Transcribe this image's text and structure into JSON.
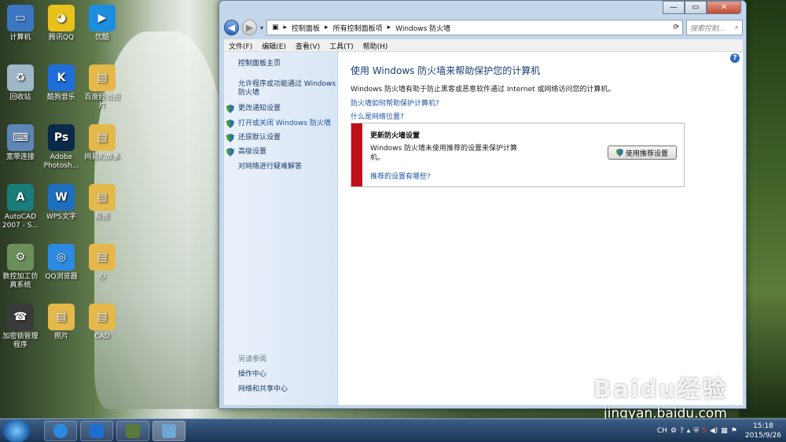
{
  "desktop": {
    "icons": [
      {
        "label": "计算机",
        "color": "#3c76c2",
        "glyph": "▭",
        "icon": "computer-icon"
      },
      {
        "label": "腾讯QQ",
        "color": "#e8c21a",
        "glyph": "◕",
        "icon": "qq-icon"
      },
      {
        "label": "优酷",
        "color": "#1c8ee0",
        "glyph": "▶",
        "icon": "youku-icon"
      },
      {
        "label": "回收站",
        "color": "#9fb6c9",
        "glyph": "♻",
        "icon": "recycle-bin-icon"
      },
      {
        "label": "酷狗音乐",
        "color": "#1e6fd9",
        "glyph": "K",
        "icon": "kugou-icon"
      },
      {
        "label": "百度经验图片",
        "color": "#e4b84a",
        "glyph": "▤",
        "icon": "folder-icon"
      },
      {
        "label": "宽带连接",
        "color": "#5e87b8",
        "glyph": "⌨",
        "icon": "broadband-icon"
      },
      {
        "label": "Adobe Photosh...",
        "color": "#0b2a4a",
        "glyph": "Ps",
        "icon": "photoshop-icon"
      },
      {
        "label": "网易的故事",
        "color": "#e4b84a",
        "glyph": "▤",
        "icon": "folder-icon"
      },
      {
        "label": "AutoCAD 2007 - S...",
        "color": "#1a7c7a",
        "glyph": "A",
        "icon": "autocad-icon"
      },
      {
        "label": "WPS文字",
        "color": "#1f6fbf",
        "glyph": "W",
        "icon": "wps-icon"
      },
      {
        "label": "原图",
        "color": "#e4b84a",
        "glyph": "▤",
        "icon": "folder-icon"
      },
      {
        "label": "数控加工仿真系统",
        "color": "#6b8f5a",
        "glyph": "⚙",
        "icon": "cnc-sim-icon"
      },
      {
        "label": "QQ浏览器",
        "color": "#2c8be0",
        "glyph": "◎",
        "icon": "qq-browser-icon"
      },
      {
        "label": "心",
        "color": "#e4b84a",
        "glyph": "▤",
        "icon": "folder-icon"
      },
      {
        "label": "加密锁管理程序",
        "color": "#3a3a3a",
        "glyph": "☎",
        "icon": "dongle-manager-icon"
      },
      {
        "label": "照片",
        "color": "#e4b84a",
        "glyph": "▤",
        "icon": "folder-icon"
      },
      {
        "label": "CAD",
        "color": "#e4b84a",
        "glyph": "▤",
        "icon": "folder-icon"
      }
    ]
  },
  "window": {
    "breadcrumb": [
      "控制面板",
      "所有控制面板项",
      "Windows 防火墙"
    ],
    "search_placeholder": "搜索控制...",
    "menu": [
      "文件(F)",
      "编辑(E)",
      "查看(V)",
      "工具(T)",
      "帮助(H)"
    ],
    "left": {
      "home": "控制面板主页",
      "allow_line1": "允许程序或功能通过 Windows",
      "allow_line2": "防火墙",
      "change_notify": "更改通知设置",
      "toggle_firewall": "打开或关闭 Windows 防火墙",
      "restore_defaults": "还原默认设置",
      "advanced": "高级设置",
      "troubleshoot": "对网络进行疑难解答",
      "see_also": "另请参阅",
      "action_center": "操作中心",
      "network_center": "网络和共享中心"
    },
    "main": {
      "title": "使用 Windows 防火墙来帮助保护您的计算机",
      "desc": "Windows 防火墙有助于防止黑客或恶意软件通过 Internet 或网络访问您的计算机。",
      "link_how": "防火墙如何帮助保护计算机?",
      "link_location": "什么是网络位置?",
      "panel_title": "更新防火墙设置",
      "panel_desc": "Windows 防火墙未使用推荐的设置来保护计算机。",
      "panel_link": "推荐的设置有哪些?",
      "use_recommended": "使用推荐设置"
    }
  },
  "watermark": {
    "logo": "Baidu经验",
    "url": "jingyan.baidu.com"
  },
  "taskbar": {
    "tray_lang": "CH",
    "time": "15:18",
    "date": "2015/9/26"
  }
}
